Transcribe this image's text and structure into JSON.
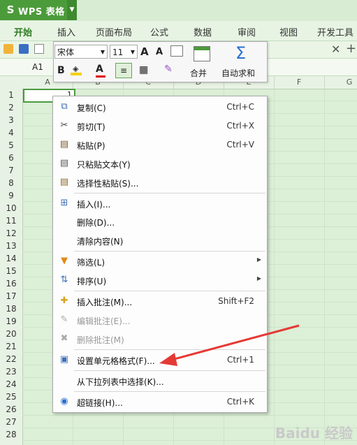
{
  "app": {
    "name": "WPS 表格",
    "logo": "S"
  },
  "ribbon_tabs": [
    "开始",
    "插入",
    "页面布局",
    "公式",
    "数据",
    "审阅",
    "视图",
    "开发工具"
  ],
  "namebox": "A1",
  "columns": [
    "A",
    "B",
    "C",
    "D",
    "E",
    "F",
    "G"
  ],
  "rows": [
    "1",
    "2",
    "3",
    "4",
    "5",
    "6",
    "7",
    "8",
    "9",
    "10",
    "11",
    "12",
    "13",
    "14",
    "15",
    "16",
    "17",
    "18",
    "19",
    "20",
    "21",
    "22",
    "23",
    "24",
    "25",
    "26",
    "27",
    "28"
  ],
  "cell_a1": "1",
  "minibar": {
    "font": "宋体",
    "size": "11",
    "grow": "A",
    "shrink": "A",
    "bold": "B",
    "font_color": "A",
    "merge": "合并",
    "autosum": "自动求和"
  },
  "menu": [
    {
      "label": "复制(C)",
      "shortcut": "Ctrl+C",
      "icon": "copy-icon",
      "disabled": false
    },
    {
      "label": "剪切(T)",
      "shortcut": "Ctrl+X",
      "icon": "scissors-icon",
      "disabled": false
    },
    {
      "label": "粘贴(P)",
      "shortcut": "Ctrl+V",
      "icon": "paste-icon",
      "disabled": false
    },
    {
      "label": "只粘贴文本(Y)",
      "shortcut": "",
      "icon": "paste-text-icon",
      "disabled": false
    },
    {
      "label": "选择性粘贴(S)...",
      "shortcut": "",
      "icon": "paste-special-icon",
      "disabled": false
    },
    {
      "label": "插入(I)...",
      "shortcut": "",
      "icon": "insert-icon",
      "disabled": false
    },
    {
      "label": "删除(D)...",
      "shortcut": "",
      "icon": "",
      "disabled": false
    },
    {
      "label": "清除内容(N)",
      "shortcut": "",
      "icon": "",
      "disabled": false
    },
    {
      "label": "筛选(L)",
      "shortcut": "",
      "icon": "filter-icon",
      "disabled": false,
      "submenu": true
    },
    {
      "label": "排序(U)",
      "shortcut": "",
      "icon": "sort-icon",
      "disabled": false,
      "submenu": true
    },
    {
      "label": "插入批注(M)...",
      "shortcut": "Shift+F2",
      "icon": "insert-comment-icon",
      "disabled": false
    },
    {
      "label": "编辑批注(E)...",
      "shortcut": "",
      "icon": "edit-comment-icon",
      "disabled": true
    },
    {
      "label": "删除批注(M)",
      "shortcut": "",
      "icon": "delete-comment-icon",
      "disabled": true
    },
    {
      "label": "设置单元格格式(F)...",
      "shortcut": "Ctrl+1",
      "icon": "format-cells-icon",
      "disabled": false
    },
    {
      "label": "从下拉列表中选择(K)...",
      "shortcut": "",
      "icon": "",
      "disabled": false
    },
    {
      "label": "超链接(H)...",
      "shortcut": "Ctrl+K",
      "icon": "hyperlink-icon",
      "disabled": false
    }
  ],
  "colors": {
    "accent": "#4c9b3a",
    "sheet_bg": "#dcefd7",
    "arrow": "#e53935",
    "font_color_bar": "#e00000",
    "fill_color_bar": "#f2d200"
  },
  "watermark": "Baidu 经验"
}
